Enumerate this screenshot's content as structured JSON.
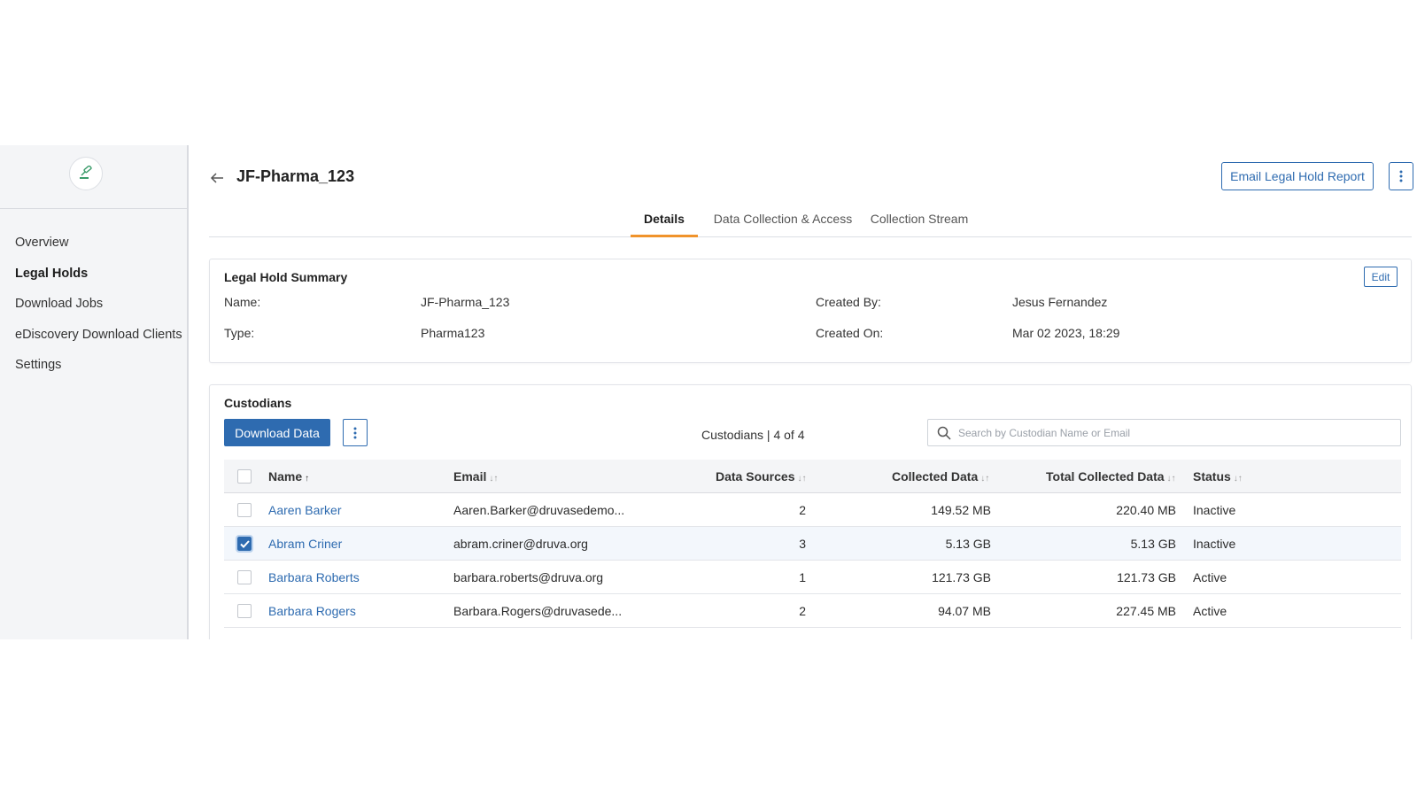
{
  "sidebar": {
    "items": [
      {
        "label": "Overview"
      },
      {
        "label": "Legal Holds"
      },
      {
        "label": "Download Jobs"
      },
      {
        "label": "eDiscovery Download Clients"
      },
      {
        "label": "Settings"
      }
    ],
    "active_index": 1
  },
  "header": {
    "title": "JF-Pharma_123",
    "report_button": "Email Legal Hold Report"
  },
  "tabs": [
    {
      "label": "Details",
      "active": true
    },
    {
      "label": "Data Collection & Access",
      "active": false
    },
    {
      "label": "Collection Stream",
      "active": false
    }
  ],
  "summary": {
    "title": "Legal Hold Summary",
    "edit_label": "Edit",
    "name_label": "Name:",
    "name_value": "JF-Pharma_123",
    "type_label": "Type:",
    "type_value": "Pharma123",
    "created_by_label": "Created By:",
    "created_by_value": "Jesus Fernandez",
    "created_on_label": "Created On:",
    "created_on_value": "Mar 02 2023, 18:29"
  },
  "custodians": {
    "title": "Custodians",
    "download_button": "Download Data",
    "count_text": "Custodians | 4 of 4",
    "search_placeholder": "Search by Custodian Name or Email",
    "columns": {
      "name": "Name",
      "email": "Email",
      "data_sources": "Data Sources",
      "collected": "Collected Data",
      "total": "Total Collected Data",
      "status": "Status"
    },
    "rows": [
      {
        "name": "Aaren Barker",
        "email": "Aaren.Barker@druvasedemo...",
        "data_sources": "2",
        "collected": "149.52 MB",
        "total": "220.40 MB",
        "status": "Inactive",
        "checked": false
      },
      {
        "name": "Abram Criner",
        "email": "abram.criner@druva.org",
        "data_sources": "3",
        "collected": "5.13 GB",
        "total": "5.13 GB",
        "status": "Inactive",
        "checked": true
      },
      {
        "name": "Barbara Roberts",
        "email": "barbara.roberts@druva.org",
        "data_sources": "1",
        "collected": "121.73 GB",
        "total": "121.73 GB",
        "status": "Active",
        "checked": false
      },
      {
        "name": "Barbara Rogers",
        "email": "Barbara.Rogers@druvasede...",
        "data_sources": "2",
        "collected": "94.07 MB",
        "total": "227.45 MB",
        "status": "Active",
        "checked": false
      }
    ]
  },
  "colors": {
    "accent": "#2e6bb0",
    "tab_underline": "#f0932b",
    "sidebar_bg": "#f4f5f7"
  }
}
